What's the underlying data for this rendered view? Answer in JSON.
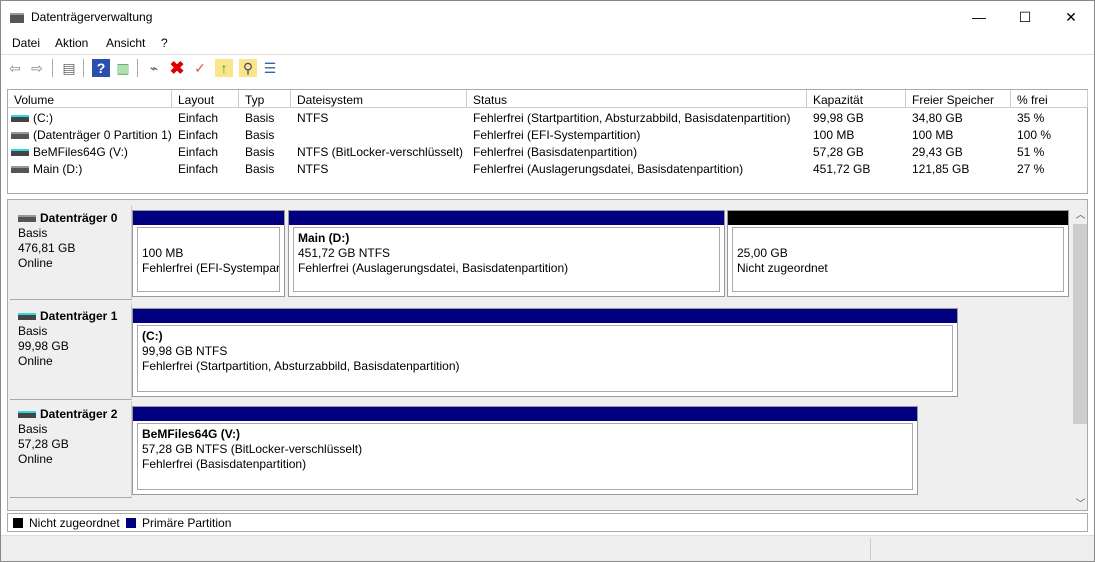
{
  "window": {
    "title": "Datenträgerverwaltung",
    "minimize": "—",
    "maximize": "☐",
    "close": "✕"
  },
  "menu": [
    "Datei",
    "Aktion",
    "Ansicht",
    "?"
  ],
  "toolbar": [
    "back-icon",
    "forward-icon",
    "console-tree-icon",
    "help-icon",
    "action-pane-icon",
    "connect-disk-icon",
    "delete-icon",
    "properties-icon",
    "export-icon",
    "find-icon",
    "settings-list-icon"
  ],
  "columns": [
    "Volume",
    "Layout",
    "Typ",
    "Dateisystem",
    "Status",
    "Kapazität",
    "Freier Speicher",
    "% frei"
  ],
  "volumes": [
    {
      "icon": "cyan",
      "cells": [
        "(C:)",
        "Einfach",
        "Basis",
        "NTFS",
        "Fehlerfrei (Startpartition, Absturzabbild, Basisdatenpartition)",
        "99,98 GB",
        "34,80 GB",
        "35 %"
      ]
    },
    {
      "icon": "gray",
      "cells": [
        "(Datenträger 0 Partition 1)",
        "Einfach",
        "Basis",
        "",
        "Fehlerfrei (EFI-Systempartition)",
        "100 MB",
        "100 MB",
        "100 %"
      ]
    },
    {
      "icon": "cyan",
      "cells": [
        "BeMFiles64G (V:)",
        "Einfach",
        "Basis",
        "NTFS (BitLocker-verschlüsselt)",
        "Fehlerfrei (Basisdatenpartition)",
        "57,28 GB",
        "29,43 GB",
        "51 %"
      ]
    },
    {
      "icon": "gray",
      "cells": [
        "Main (D:)",
        "Einfach",
        "Basis",
        "NTFS",
        "Fehlerfrei (Auslagerungsdatei, Basisdatenpartition)",
        "451,72 GB",
        "121,85 GB",
        "27 %"
      ]
    }
  ],
  "disks": [
    {
      "name": "Datenträger 0",
      "type": "Basis",
      "size": "476,81 GB",
      "state": "Online",
      "partitions": [
        {
          "name": "",
          "line1": "100 MB",
          "line2": "Fehlerfrei (EFI-Systempartition)"
        },
        {
          "name": "Main  (D:)",
          "line1": "451,72 GB NTFS",
          "line2": "Fehlerfrei (Auslagerungsdatei, Basisdatenpartition)"
        },
        {
          "name": "",
          "line1": "25,00 GB",
          "line2": "Nicht zugeordnet"
        }
      ]
    },
    {
      "name": "Datenträger 1",
      "type": "Basis",
      "size": "99,98 GB",
      "state": "Online",
      "partitions": [
        {
          "name": " (C:)",
          "line1": "99,98 GB NTFS",
          "line2": "Fehlerfrei (Startpartition, Absturzabbild, Basisdatenpartition)"
        }
      ]
    },
    {
      "name": "Datenträger 2",
      "type": "Basis",
      "size": "57,28 GB",
      "state": "Online",
      "partitions": [
        {
          "name": "BeMFiles64G  (V:)",
          "line1": "57,28 GB NTFS (BitLocker-verschlüsselt)",
          "line2": "Fehlerfrei (Basisdatenpartition)"
        }
      ]
    }
  ],
  "legend": [
    {
      "label": "Nicht zugeordnet",
      "color": "#000000"
    },
    {
      "label": "Primäre Partition",
      "color": "#000080"
    }
  ],
  "colors": {
    "primary": "#000080",
    "unallocated": "#000000"
  }
}
